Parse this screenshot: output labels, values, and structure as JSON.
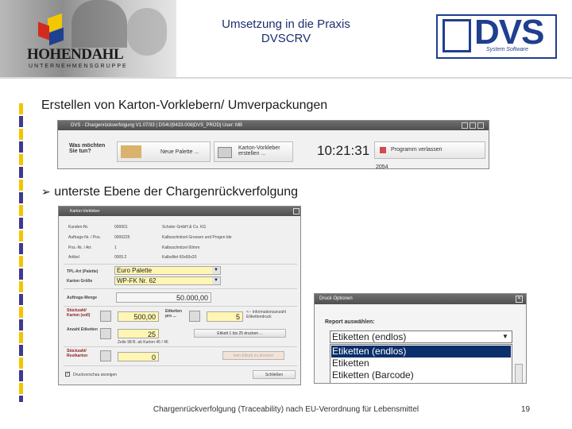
{
  "header": {
    "company_name": "HOHENDAHL",
    "company_sub": "UNTERNEHMENSGRUPPE",
    "title_line1": "Umsetzung in die Praxis",
    "title_line2": "DVSCRV",
    "dvs_logo": "DVS",
    "dvs_sub": "System Software"
  },
  "content": {
    "heading1": "Erstellen von Karton-Vorklebern/ Umverpackungen",
    "heading2": "unterste Ebene der Chargenrückverfolgung",
    "bullet_icon": "arrow-bullet-icon"
  },
  "window1": {
    "title": "DVS - Chargenrückverfolgung V1.07/33 | DS4U|9433.008|DVS_PROD| User: MB",
    "question": "Was möchten Sie tun?",
    "btn_new_pallet": "Neue Palette ...",
    "btn_carton_label": "Karton-Vorkleber erstellen ...",
    "clock": "10:21:31",
    "btn_exit": "Programm verlassen",
    "status_partial": "2054"
  },
  "window2": {
    "title": "Karton-Vorkleber",
    "fields": [
      {
        "label": "Kunden-Nr.",
        "value": "000001",
        "extra": "Scholer GmbH & Co. KG"
      },
      {
        "label": "Auftrags-Nr. / Pos.",
        "value": "0000225",
        "extra": "Kalbsschnitzel Grossen und Progen ble"
      },
      {
        "label": "Pos.-Nr. / Art.",
        "value": "1",
        "extra": "Kalbsschnitzel 60mm"
      },
      {
        "label": "Artikel",
        "value": "0005.2",
        "extra": "Kalbsfilet 60x60x20"
      }
    ],
    "pallet_label": "TPL-Art (Palette)",
    "pallet_value": "Euro Palette",
    "carton_label": "Karton Größe",
    "carton_value": "WP-FK Nr. 62",
    "qty_label": "Auftrags-Menge",
    "qty_value": "50.000,00",
    "row1_label": "Stückzahl/ Karton (soll)",
    "row1_value": "500,00",
    "row1_label2": "Etiketten pro ...",
    "row1_value2": "5",
    "row1_note": "<-- Informationsanzahl Etikettendruck",
    "row2_label": "Anzahl Etiketten",
    "row2_value": "25",
    "row2_button": "Etikett 1 bis 25 drucken ...",
    "row2_note": "Zeile 98 B. ab Karton 45 / 46",
    "row3_label": "Stückzahl/ Restkarton",
    "row3_value": "0",
    "row3_button": "kein Etikett zu drucken",
    "preview_label": "Druckvorschau anzeigen",
    "close_button": "Schließen"
  },
  "dialog": {
    "title": "Druck Optionen",
    "label": "Report auswählen:",
    "selected": "Etiketten (endlos)",
    "options": [
      "Etiketten (endlos)",
      "Etiketten",
      "Etiketten (Barcode)"
    ]
  },
  "footer": {
    "text": "Chargenrückverfolgung (Traceability) nach EU-Verordnung für Lebensmittel",
    "page": "19"
  },
  "colors": {
    "accent_blue": "#1f3f8f",
    "title_blue": "#1c2f6e",
    "bar_purple": "#3e3a8f",
    "bar_yellow": "#f4c400",
    "field_yellow": "#fff6b3",
    "selection": "#0b2f6b"
  }
}
